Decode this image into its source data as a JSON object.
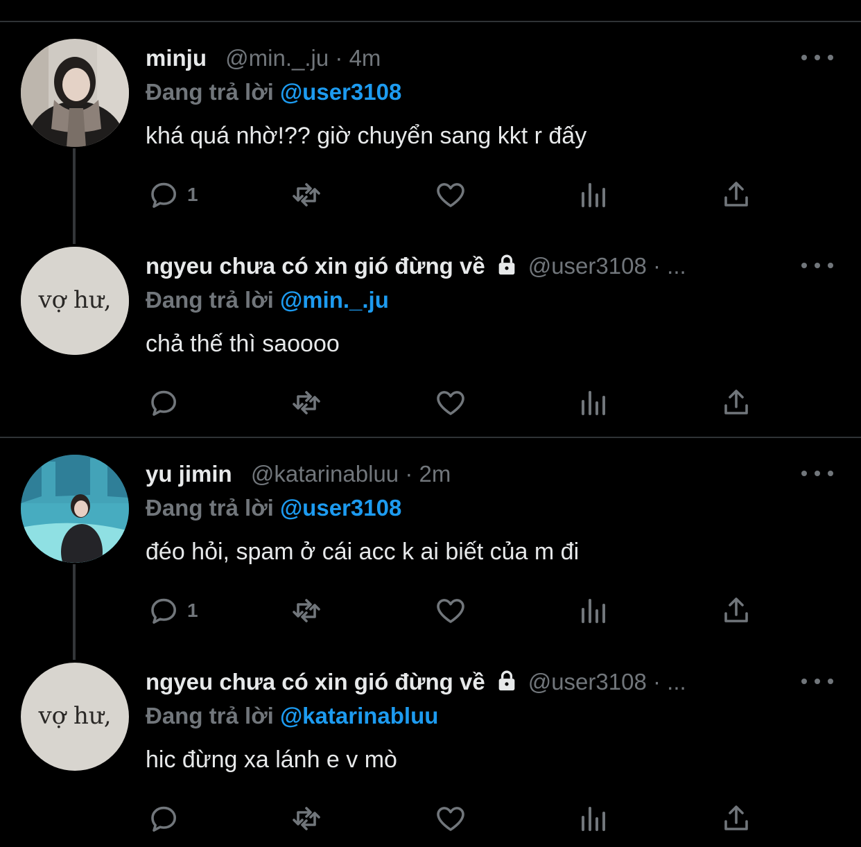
{
  "replying_prefix": "Đang trả lời",
  "tweets": [
    {
      "name": "minju",
      "handle": "@min._.ju",
      "dot": "·",
      "time": "4m",
      "locked": false,
      "reply_to": "@user3108",
      "text": "khá quá nhờ!?? giờ chuyển sang kkt r đấy",
      "reply_count": "1",
      "avatar": "photo-girl-scarf"
    },
    {
      "name": "ngyeu chưa có xin gió đừng về",
      "handle": "@user3108",
      "dot": "·",
      "time": "...",
      "locked": true,
      "reply_to": "@min._.ju",
      "text": "chả thế thì saoooo",
      "reply_count": "",
      "avatar": "text-image",
      "avatar_text": "vợ hư,"
    },
    {
      "name": "yu jimin",
      "handle": "@katarinabluu",
      "dot": "·",
      "time": "2m",
      "locked": false,
      "reply_to": "@user3108",
      "text": "đéo hỏi, spam ở cái acc k ai biết của m đi",
      "reply_count": "1",
      "avatar": "photo-aquarium"
    },
    {
      "name": "ngyeu chưa có xin gió đừng về",
      "handle": "@user3108",
      "dot": "·",
      "time": "...",
      "locked": true,
      "reply_to": "@katarinabluu",
      "text": "hic đừng xa lánh e v mò",
      "reply_count": "",
      "avatar": "text-image",
      "avatar_text": "vợ hư,"
    }
  ],
  "colors": {
    "background": "#000000",
    "text": "#e7e9ea",
    "secondary": "#71767b",
    "accent": "#1d9bf0",
    "separator": "#2f3336"
  }
}
